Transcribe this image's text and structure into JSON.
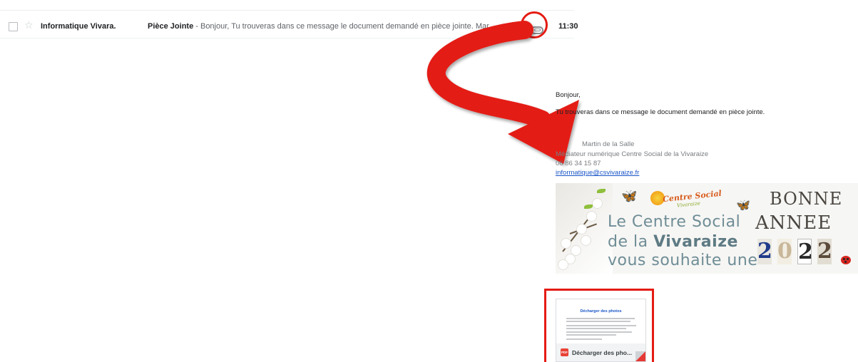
{
  "email_row": {
    "sender": "Informatique Vivara.",
    "subject": "Pièce Jointe",
    "snippet": " - Bonjour, Tu trouveras dans ce message le document demandé en pièce jointe. Mar...",
    "time": "11:30",
    "attachment_icon": "paperclip-icon"
  },
  "email_body": {
    "greeting": "Bonjour,",
    "message": "Tu trouveras dans ce message le document demandé en pièce jointe.",
    "signature_name": "Martin de la Salle",
    "signature_role": "Médiateur numérique Centre Social de la Vivaraize",
    "signature_phone": "06 86 34 15 87",
    "signature_email": "informatique@csvivaraize.fr"
  },
  "banner": {
    "logo_text": "Centre Social",
    "logo_sub": "Vivaraize",
    "line1": "Le Centre Social",
    "line2_prefix": "de la ",
    "line2_bold": "Vivaraize",
    "line3": "vous souhaite une",
    "greet1": "BONNE",
    "greet2": "ANNEE",
    "year_digits": [
      "2",
      "0",
      "2",
      "2"
    ]
  },
  "attachment": {
    "doc_title": "Décharger des photos",
    "type_badge": "PDF",
    "name": "Décharger des pho..."
  },
  "colors": {
    "highlight": "#e41b13",
    "link": "#1a56c7"
  }
}
